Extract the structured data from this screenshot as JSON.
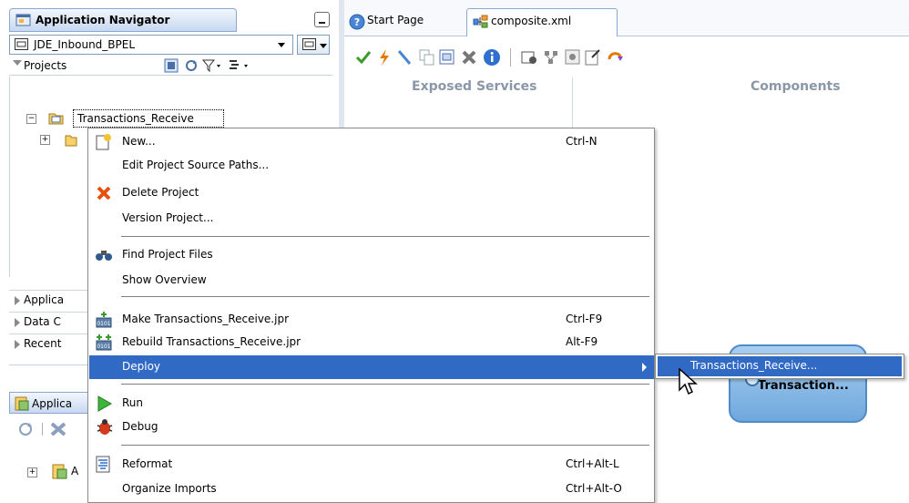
{
  "left_panel": {
    "tab_title": "Application Navigator",
    "app_combo_value": "JDE_Inbound_BPEL",
    "projects_label": "Projects",
    "selected_project": "Transactions_Receive",
    "accordions": [
      {
        "label": "Applica"
      },
      {
        "label": "Data C"
      },
      {
        "label": "Recent"
      }
    ],
    "bottom_tab_label": "Applica",
    "bottom_tree_label": "A"
  },
  "editor": {
    "tabs": [
      {
        "label": "Start Page"
      },
      {
        "label": "composite.xml"
      }
    ],
    "columns": {
      "exposed_services": "Exposed Services",
      "components": "Components"
    },
    "component_label": "Transaction..."
  },
  "context_menu": {
    "items": [
      {
        "label": "New...",
        "shortcut": "Ctrl-N",
        "icon": "new-gallery-icon"
      },
      {
        "label": "Edit Project Source Paths...",
        "shortcut": ""
      },
      {
        "label": "Delete Project",
        "shortcut": "",
        "icon": "delete-x-icon"
      },
      {
        "label": "Version Project...",
        "shortcut": ""
      },
      {
        "label": "Find Project Files",
        "shortcut": "",
        "icon": "binoculars-icon"
      },
      {
        "label": "Show Overview",
        "shortcut": ""
      },
      {
        "label": "Make Transactions_Receive.jpr",
        "shortcut": "Ctrl-F9",
        "icon": "make-icon"
      },
      {
        "label": "Rebuild Transactions_Receive.jpr",
        "shortcut": "Alt-F9",
        "icon": "rebuild-icon"
      },
      {
        "label": "Deploy",
        "shortcut": "",
        "has_submenu": true
      },
      {
        "label": "Run",
        "shortcut": "",
        "icon": "run-icon"
      },
      {
        "label": "Debug",
        "shortcut": "",
        "icon": "debug-icon"
      },
      {
        "label": "Reformat",
        "shortcut": "Ctrl+Alt-L",
        "icon": "reformat-icon"
      },
      {
        "label": "Organize Imports",
        "shortcut": "Ctrl+Alt-O"
      }
    ],
    "submenu_item": "Transactions_Receive..."
  },
  "colors": {
    "menu_highlight": "#316ac5",
    "tab_gradient_end": "#c7d8f1",
    "component_fill": "#6fa8dd"
  }
}
